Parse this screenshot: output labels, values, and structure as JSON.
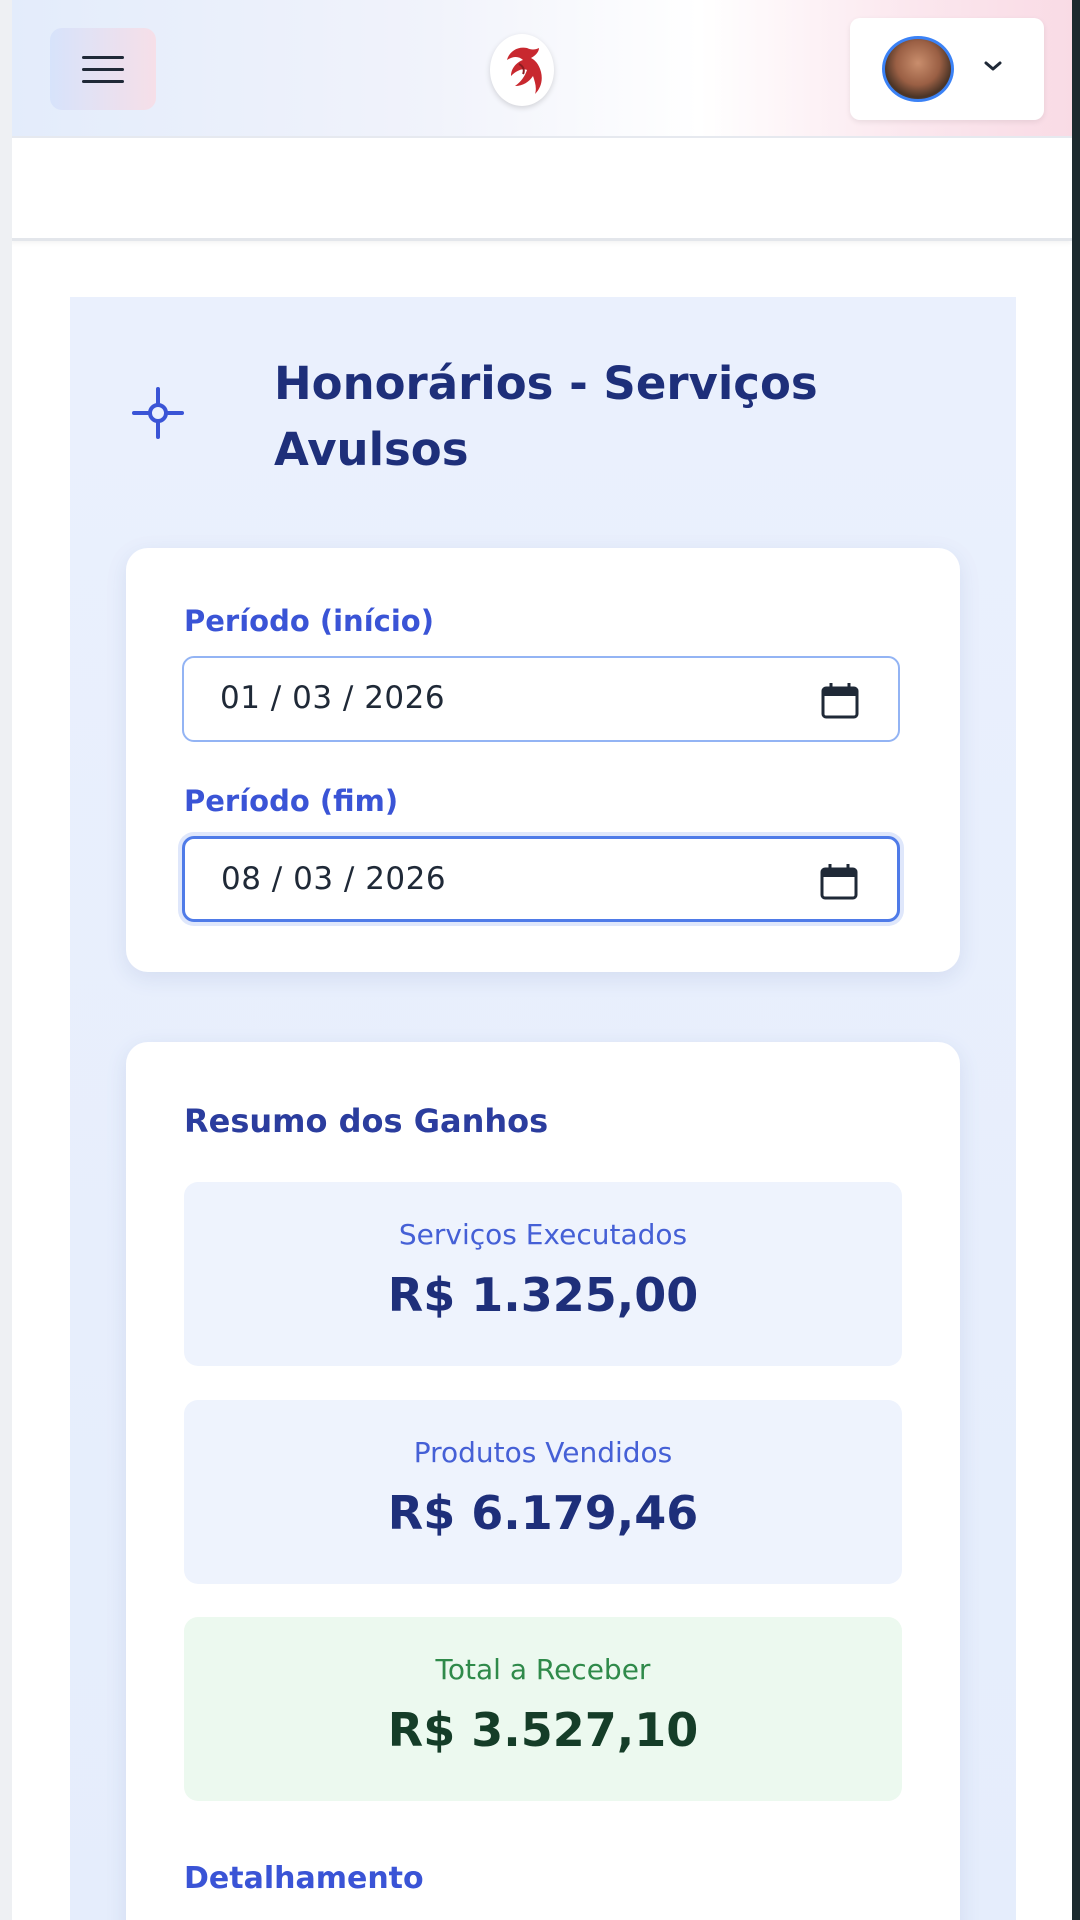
{
  "header": {
    "menu_icon": "hamburger-menu-icon",
    "logo_icon": "bird-logo-icon",
    "user_menu_icon": "chevron-down-icon"
  },
  "page": {
    "title": "Honorários - Serviços Avulsos",
    "title_icon": "crosshair-sparkle-icon"
  },
  "filters": {
    "start_label": "Período (início)",
    "start_value": "01 / 03 / 2026",
    "end_label": "Período (fim)",
    "end_value": "08 / 03 / 2026",
    "calendar_icon": "calendar-icon"
  },
  "summary": {
    "title": "Resumo dos Ganhos",
    "items": [
      {
        "label": "Serviços Executados",
        "value": "R$ 1.325,00"
      },
      {
        "label": "Produtos Vendidos",
        "value": "R$ 6.179,46"
      },
      {
        "label": "Total a Receber",
        "value": "R$ 3.527,10"
      }
    ],
    "detail_title": "Detalhamento"
  },
  "colors": {
    "accent": "#3a54d6",
    "title": "#1e2f7a",
    "success_bg": "#ecf9ef",
    "success_text": "#153d28"
  }
}
